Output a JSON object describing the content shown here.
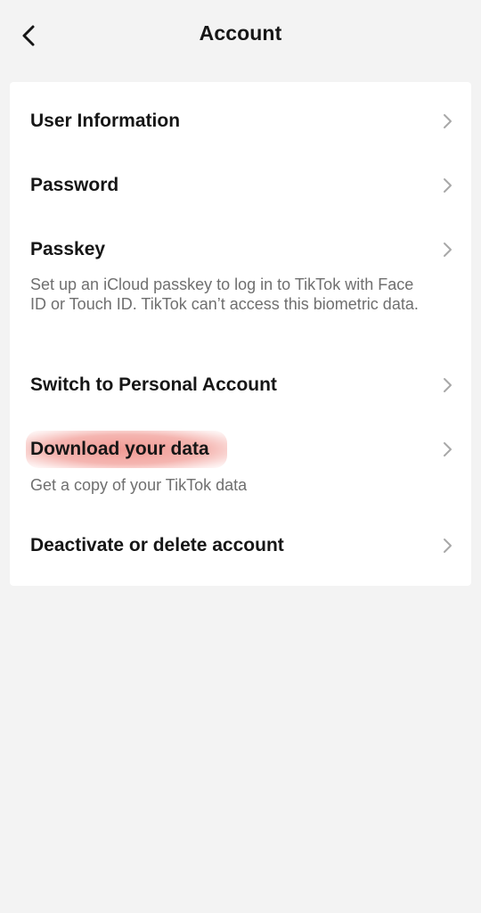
{
  "header": {
    "title": "Account",
    "back_icon": "chevron-left-icon"
  },
  "rows": [
    {
      "label": "User Information",
      "description": ""
    },
    {
      "label": "Password",
      "description": ""
    },
    {
      "label": "Passkey",
      "description": "Set up an iCloud passkey to log in to TikTok with Face ID or Touch ID. TikTok can’t access this biometric data."
    },
    {
      "label": "Switch to Personal Account",
      "description": ""
    },
    {
      "label": "Download your data",
      "description": "Get a copy of your TikTok data",
      "highlighted": true
    },
    {
      "label": "Deactivate or delete account",
      "description": ""
    }
  ],
  "colors": {
    "background": "#f3f3f3",
    "card": "#ffffff",
    "text": "#161616",
    "secondary_text": "#6f6f6f",
    "chevron": "#a8a8a8",
    "highlight": "#ec7870"
  }
}
